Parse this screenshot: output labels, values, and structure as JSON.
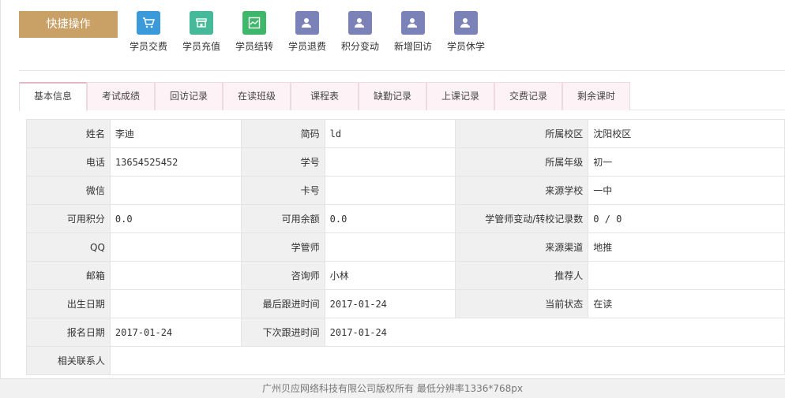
{
  "quick_actions": {
    "title": "快捷操作",
    "items": [
      {
        "label": "学员交费",
        "icon": "cart-icon",
        "color": "#3b9ad9"
      },
      {
        "label": "学员充值",
        "icon": "store-icon",
        "color": "#45b99a"
      },
      {
        "label": "学员结转",
        "icon": "chart-icon",
        "color": "#3fb76b"
      },
      {
        "label": "学员退费",
        "icon": "user-edit-icon",
        "color": "#7b82b8"
      },
      {
        "label": "积分变动",
        "icon": "user-edit-icon",
        "color": "#7b82b8"
      },
      {
        "label": "新增回访",
        "icon": "user-edit-icon",
        "color": "#7b82b8"
      },
      {
        "label": "学员休学",
        "icon": "user-edit-icon",
        "color": "#7b82b8"
      }
    ]
  },
  "tabs": [
    "基本信息",
    "考试成绩",
    "回访记录",
    "在读班级",
    "课程表",
    "缺勤记录",
    "上课记录",
    "交费记录",
    "剩余课时"
  ],
  "active_tab": "基本信息",
  "info": {
    "rows": [
      [
        {
          "k": "姓名",
          "v": "李迪"
        },
        {
          "k": "简码",
          "v": "ld"
        },
        {
          "k": "所属校区",
          "v": "沈阳校区"
        }
      ],
      [
        {
          "k": "电话",
          "v": "13654525452"
        },
        {
          "k": "学号",
          "v": ""
        },
        {
          "k": "所属年级",
          "v": "初一"
        }
      ],
      [
        {
          "k": "微信",
          "v": ""
        },
        {
          "k": "卡号",
          "v": ""
        },
        {
          "k": "来源学校",
          "v": "一中"
        }
      ],
      [
        {
          "k": "可用积分",
          "v": "0.0"
        },
        {
          "k": "可用余额",
          "v": "0.0"
        },
        {
          "k": "学管师变动/转校记录数",
          "v": "0 / 0"
        }
      ],
      [
        {
          "k": "QQ",
          "v": ""
        },
        {
          "k": "学管师",
          "v": ""
        },
        {
          "k": "来源渠道",
          "v": "地推"
        }
      ],
      [
        {
          "k": "邮箱",
          "v": ""
        },
        {
          "k": "咨询师",
          "v": "小林"
        },
        {
          "k": "推荐人",
          "v": ""
        }
      ],
      [
        {
          "k": "出生日期",
          "v": ""
        },
        {
          "k": "最后跟进时间",
          "v": "2017-01-24"
        },
        {
          "k": "当前状态",
          "v": "在读"
        }
      ],
      [
        {
          "k": "报名日期",
          "v": "2017-01-24"
        },
        {
          "k": "下次跟进时间",
          "v": "2017-01-24"
        }
      ],
      [
        {
          "k": "相关联系人",
          "v": ""
        }
      ]
    ]
  },
  "footer": "广州贝应网络科技有限公司版权所有 最低分辨率1336*768px"
}
